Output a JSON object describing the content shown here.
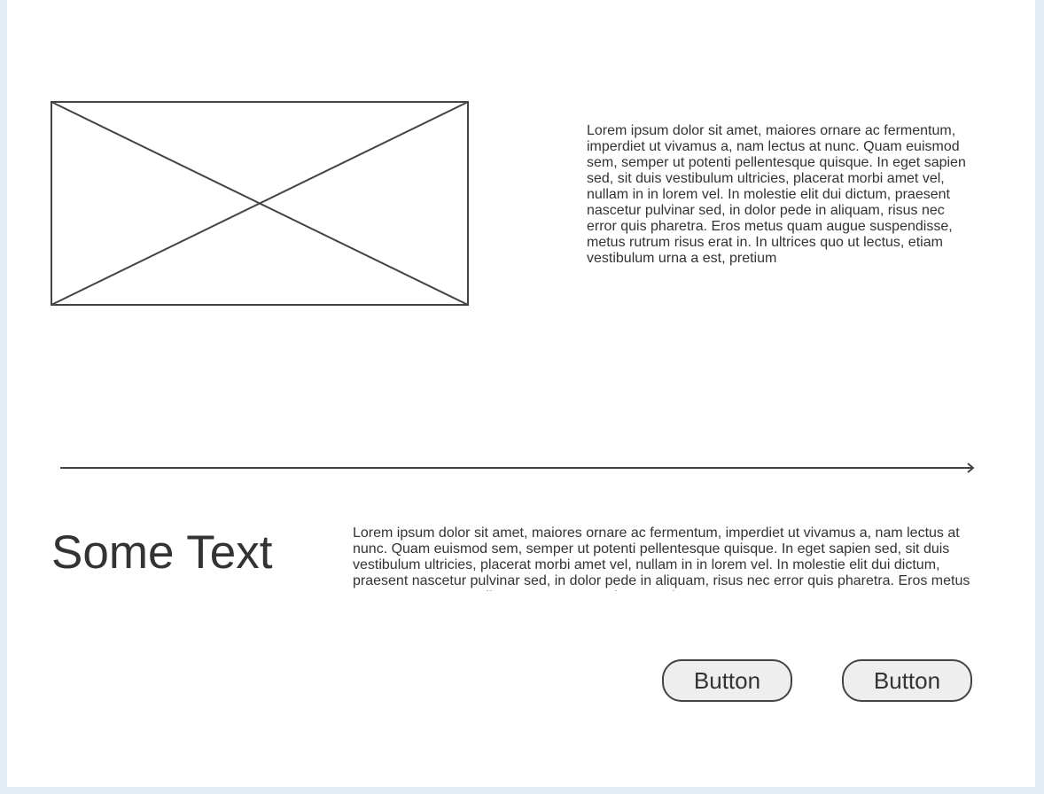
{
  "image_placeholder": {
    "icon": "image-placeholder-icon"
  },
  "top_paragraph": {
    "text": "Lorem ipsum dolor sit amet, maiores ornare ac fermentum, imperdiet ut vivamus a, nam lectus at nunc. Quam euismod sem, semper ut potenti pellentesque quisque. In eget sapien sed, sit duis vestibulum ultricies, placerat morbi amet vel, nullam in in lorem vel. In molestie elit dui dictum, praesent nascetur pulvinar sed, in dolor pede in aliquam, risus nec error quis pharetra. Eros metus quam augue suspendisse, metus rutrum risus erat in.  In ultrices quo ut lectus, etiam vestibulum urna a est, pretium"
  },
  "divider": {
    "icon": "arrow-right-icon"
  },
  "heading": {
    "text": "Some Text"
  },
  "bottom_paragraph": {
    "text": "Lorem ipsum dolor sit amet, maiores ornare ac fermentum, imperdiet ut vivamus a, nam lectus at nunc. Quam euismod sem, semper ut potenti pellentesque quisque. In eget sapien sed, sit duis vestibulum ultricies, placerat morbi amet vel, nullam in in lorem vel. In molestie elit dui dictum, praesent nascetur pulvinar sed, in dolor pede in aliquam, risus nec error quis pharetra. Eros metus quam augue suspendisse, metus rutrum risus erat in."
  },
  "buttons": [
    {
      "label": "Button"
    },
    {
      "label": "Button"
    }
  ],
  "colors": {
    "page_background": "#e3ebf5",
    "canvas_background": "#ffffff",
    "stroke": "#444444",
    "button_fill": "#eeeeee",
    "text": "#333333"
  }
}
